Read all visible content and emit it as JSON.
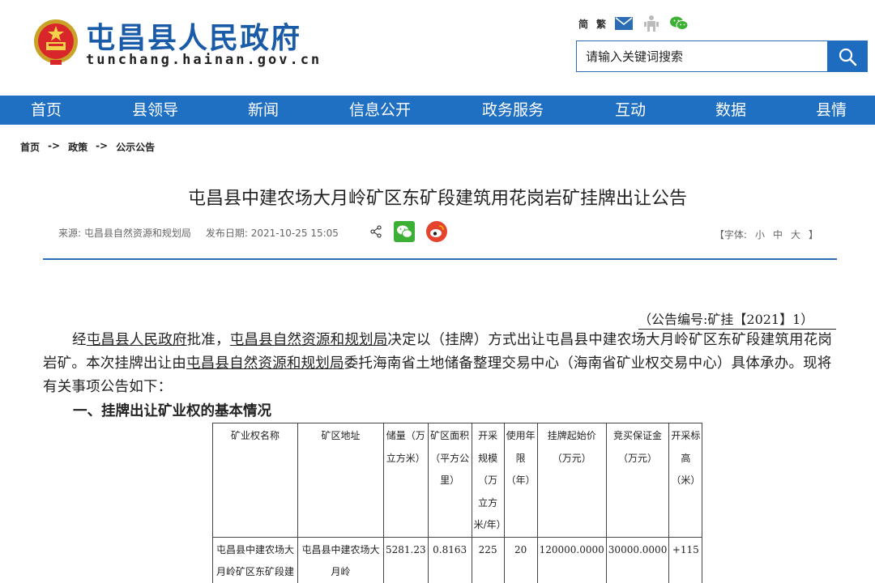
{
  "site": {
    "title": "屯昌县人民政府",
    "domain": "tunchang.hainan.gov.cn",
    "emblem_icon": "national-emblem-icon"
  },
  "tools": {
    "simplified": "简",
    "traditional": "繁",
    "icons": [
      "mail-icon",
      "accessibility-icon",
      "wechat-icon"
    ]
  },
  "search": {
    "placeholder": "请输入关键词搜索",
    "button_icon": "search-icon"
  },
  "nav": {
    "items": [
      "首页",
      "县领导",
      "新闻",
      "信息公开",
      "政务服务",
      "互动",
      "数据",
      "县情"
    ]
  },
  "breadcrumb": {
    "items": [
      "首页",
      "政策",
      "公示公告"
    ],
    "separator": "->"
  },
  "article": {
    "title": "屯昌县中建农场大月岭矿区东矿段建筑用花岗岩矿挂牌出让公告",
    "source_label": "来源:",
    "source": "屯昌县自然资源和规划局",
    "date_label": "发布日期:",
    "date": "2021-10-25 15:05",
    "font_size_label_open": "【字体:",
    "font_small": "小",
    "font_medium": "中",
    "font_large": "大",
    "font_size_label_close": "】",
    "notice_number": "（公告编号:矿挂【2021】1）",
    "para_1a": "经",
    "para_link_1": "屯昌县人民政府",
    "para_1b": "批准，",
    "para_link_2": "屯昌县自然资源和规划局",
    "para_1c": "决定以（挂牌）方式出让屯昌县中建农场大月岭矿区东矿段建筑用花岗岩矿。本次挂牌出让由",
    "para_link_3": "屯昌县自然资源和规划局",
    "para_1d": "委托海南省土地储备整理交易中心（海南省矿业权交易中心）具体承办。现将有关事项公告如下：",
    "section_1": "一、挂牌出让矿业权的基本情况"
  },
  "table": {
    "headers": [
      "矿业权名称",
      "矿区地址",
      "储量（万立方米）",
      "矿区面积（平方公里）",
      "开采规模（万立方米/年）",
      "使用年限（年）",
      "挂牌起始价（万元）",
      "竞买保证金（万元）",
      "开采标高（米）"
    ],
    "rows": [
      [
        "屯昌县中建农场大月岭矿区东矿段建",
        "屯昌县中建农场大月岭",
        "5281.23",
        "0.8163",
        "225",
        "20",
        "120000.0000",
        "30000.0000",
        "+115"
      ]
    ]
  },
  "colors": {
    "brand_blue": "#1f6fc3",
    "title_blue": "#1a5ba8",
    "wechat_green": "#3cb034",
    "weibo_red": "#e6432f"
  }
}
